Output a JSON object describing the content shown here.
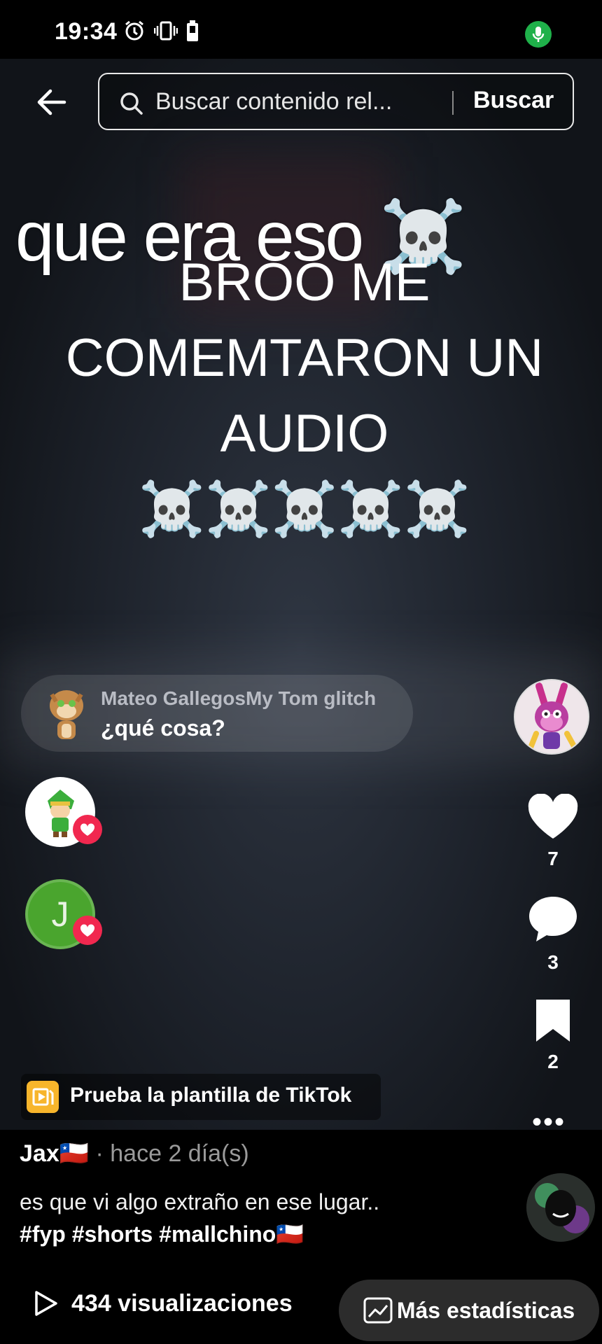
{
  "status_bar": {
    "time": "19:34"
  },
  "search": {
    "placeholder": "Buscar contenido rel...",
    "button": "Buscar"
  },
  "video": {
    "overlay_text": "que era eso ☠️",
    "caption": "BROO ME COMEMTARON UN AUDIO",
    "caption_emojis": "☠️☠️☠️☠️☠️"
  },
  "comment_bubble": {
    "username": "Mateo GallegosMy Tom glitch",
    "text": "¿qué cosa?"
  },
  "likers": [
    {
      "initial": ""
    },
    {
      "initial": "J"
    }
  ],
  "actions": {
    "likes": "7",
    "comments": "3",
    "saves": "2"
  },
  "template_banner": {
    "label": "Prueba la plantilla de TikTok"
  },
  "post": {
    "author": "Jax🇨🇱",
    "time": " · hace 2 día(s)",
    "description": "es que vi algo extraño en ese lugar..",
    "hashtags": "#fyp #shorts #mallchino🇨🇱"
  },
  "bottom_bar": {
    "views": "434 visualizaciones",
    "stats_button": "Más estadísticas"
  }
}
